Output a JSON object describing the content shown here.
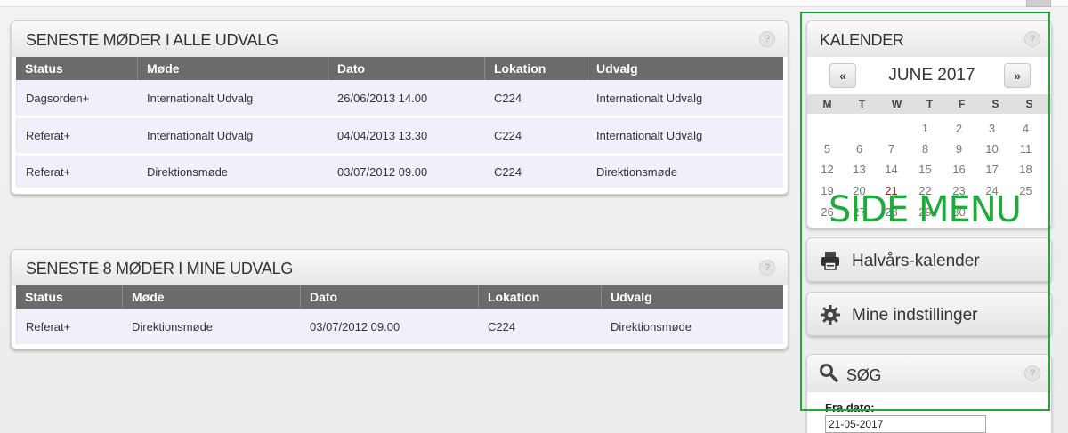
{
  "panel1": {
    "title": "SENESTE MØDER I ALLE UDVALG",
    "help": "?",
    "columns": [
      "Status",
      "Møde",
      "Dato",
      "Lokation",
      "Udvalg"
    ],
    "rows": [
      [
        "Dagsorden+",
        "Internationalt Udvalg",
        "26/06/2013 14.00",
        "C224",
        "Internationalt Udvalg"
      ],
      [
        "Referat+",
        "Internationalt Udvalg",
        "04/04/2013 13.30",
        "C224",
        "Internationalt Udvalg"
      ],
      [
        "Referat+",
        "Direktionsmøde",
        "03/07/2012 09.00",
        "C224",
        "Direktionsmøde"
      ]
    ]
  },
  "panel2": {
    "title": "SENESTE 8 MØDER I MINE UDVALG",
    "help": "?",
    "columns": [
      "Status",
      "Møde",
      "Dato",
      "Lokation",
      "Udvalg"
    ],
    "rows": [
      [
        "Referat+",
        "Direktionsmøde",
        "03/07/2012 09.00",
        "C224",
        "Direktionsmøde"
      ]
    ]
  },
  "calendar": {
    "title": "KALENDER",
    "help": "?",
    "prev": "«",
    "next": "»",
    "month": "JUNE 2017",
    "weekdays": [
      "M",
      "T",
      "W",
      "T",
      "F",
      "S",
      "S"
    ],
    "weeks": [
      [
        "",
        "",
        "",
        "1",
        "2",
        "3",
        "4"
      ],
      [
        "5",
        "6",
        "7",
        "8",
        "9",
        "10",
        "11"
      ],
      [
        "12",
        "13",
        "14",
        "15",
        "16",
        "17",
        "18"
      ],
      [
        "19",
        "20",
        "21",
        "22",
        "23",
        "24",
        "25"
      ],
      [
        "26",
        "27",
        "28",
        "29",
        "30",
        "",
        ""
      ]
    ],
    "today": "21"
  },
  "overlay": {
    "text": "SIDE MENU",
    "color": "#1faa3c"
  },
  "menu": {
    "halvaars": "Halvårs-kalender",
    "settings": "Mine indstillinger"
  },
  "search": {
    "title": "SØG",
    "help": "?",
    "from_label": "Fra dato:",
    "from_value": "21-05-2017"
  },
  "colors": {
    "header_row": "#6b6b6b",
    "row_bg": "#f0f0fa",
    "accent_green": "#1faa3c"
  }
}
